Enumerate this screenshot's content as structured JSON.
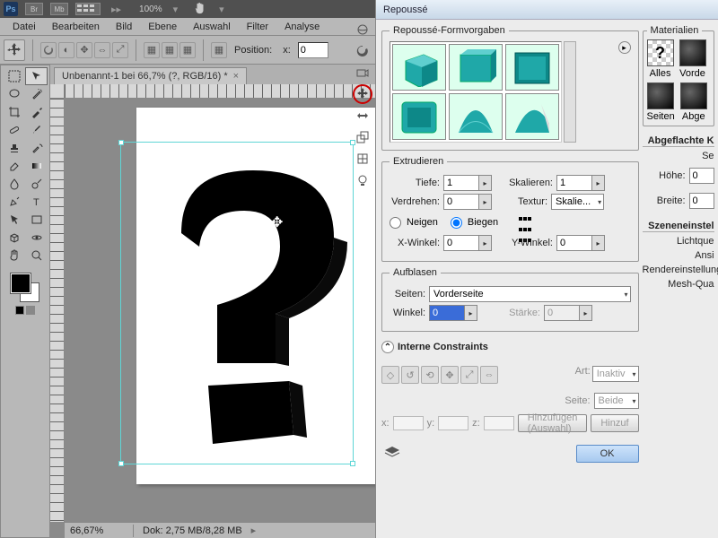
{
  "titlebar": {
    "zoom": "100%",
    "btn_br": "Br",
    "btn_mb": "Mb"
  },
  "menubar": [
    "Datei",
    "Bearbeiten",
    "Bild",
    "Ebene",
    "Auswahl",
    "Filter",
    "Analyse"
  ],
  "optionsbar": {
    "position_label": "Position:",
    "x_label": "x:",
    "x_val": "0"
  },
  "doc_tab": {
    "title": "Unbenannt-1 bei 66,7% (?, RGB/16) *"
  },
  "statusbar": {
    "zoom": "66,67%",
    "doc": "Dok: 2,75 MB/8,28 MB"
  },
  "dialog": {
    "title": "Repoussé",
    "presets_legend": "Repoussé-Formvorgaben",
    "extrude": {
      "legend": "Extrudieren",
      "depth_label": "Tiefe:",
      "depth_val": "1",
      "scale_label": "Skalieren:",
      "scale_val": "1",
      "twist_label": "Verdrehen:",
      "twist_val": "0",
      "texture_label": "Textur:",
      "texture_val": "Skalie...",
      "tilt_label": "Neigen",
      "bend_label": "Biegen",
      "xangle_label": "X-Winkel:",
      "xangle_val": "0",
      "yangle_label": "Y-Winkel:",
      "yangle_val": "0"
    },
    "inflate": {
      "legend": "Aufblasen",
      "sides_label": "Seiten:",
      "sides_val": "Vorderseite",
      "angle_label": "Winkel:",
      "angle_val": "0",
      "strength_label": "Stärke:",
      "strength_val": "0"
    },
    "constraints": {
      "header": "Interne Constraints",
      "type_label": "Art:",
      "type_val": "Inaktiv",
      "side_label": "Seite:",
      "side_val": "Beide",
      "x_label": "x:",
      "y_label": "y:",
      "z_label": "z:",
      "add_btn": "Hinzufügen (Auswahl)",
      "add2_btn": "Hinzuf"
    },
    "ok": "OK"
  },
  "materials": {
    "legend": "Materialien",
    "all": "Alles",
    "front": "Vorde",
    "sides": "Seiten",
    "back": "Abge"
  },
  "flatten": {
    "legend": "Abgeflachte K",
    "se_label": "Se",
    "height_label": "Höhe:",
    "height_val": "0",
    "width_label": "Breite:",
    "width_val": "0"
  },
  "scene": {
    "legend": "Szeneneinstel",
    "light": "Lichtque",
    "view": "Ansi",
    "render": "Rendereinstellung",
    "mesh": "Mesh-Qua"
  }
}
